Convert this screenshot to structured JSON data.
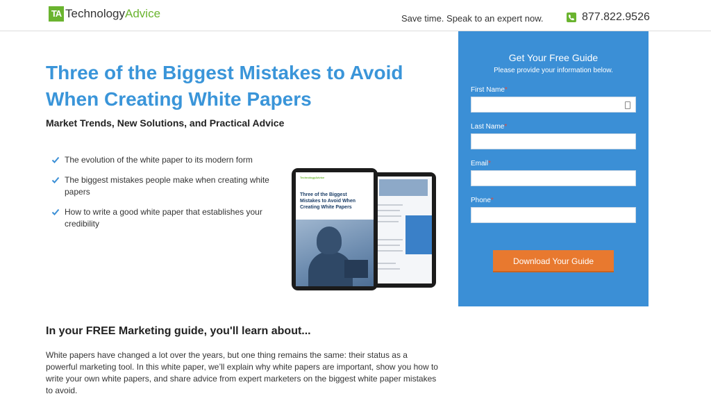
{
  "header": {
    "logo_mark": "TA",
    "logo_text_primary": "Technology",
    "logo_text_secondary": "Advice",
    "tagline": "Save time. Speak to an expert now.",
    "phone_number": "877.822.9526",
    "phone_icon": "phone-icon"
  },
  "hero": {
    "title": "Three of the Biggest Mistakes to Avoid When Creating White Papers",
    "subtitle": "Market Trends, New Solutions, and Practical Advice",
    "bullets": [
      "The evolution of the white paper to its modern form",
      "The biggest mistakes people make when creating white papers",
      "How to write a good white paper that establishes your credibility"
    ],
    "bullet_icon": "check-icon",
    "tablet_logo": "TechnologyAdvice",
    "tablet_title": "Three of the Biggest Mistakes to Avoid When Creating White Papers"
  },
  "form": {
    "title": "Get Your Free Guide",
    "subtitle": "Please provide your information below.",
    "fields": [
      {
        "label": "First Name",
        "required_mark": "*",
        "value": ""
      },
      {
        "label": "Last Name",
        "required_mark": "*",
        "value": ""
      },
      {
        "label": "Email",
        "required_mark": "*",
        "value": ""
      },
      {
        "label": "Phone",
        "required_mark": "*",
        "value": ""
      }
    ],
    "submit_label": "Download Your Guide"
  },
  "learn": {
    "heading": "In your FREE Marketing guide, you'll learn about...",
    "body": "White papers have changed a lot over the years, but one thing remains the same: their status as a powerful marketing tool. In this white paper, we’ll explain why white papers are important, show you how to write your own white papers, and share advice from expert marketers on the biggest white paper mistakes to avoid."
  },
  "colors": {
    "accent_blue": "#3b8fd6",
    "brand_green": "#6ab42f",
    "button_orange": "#e8792f"
  }
}
